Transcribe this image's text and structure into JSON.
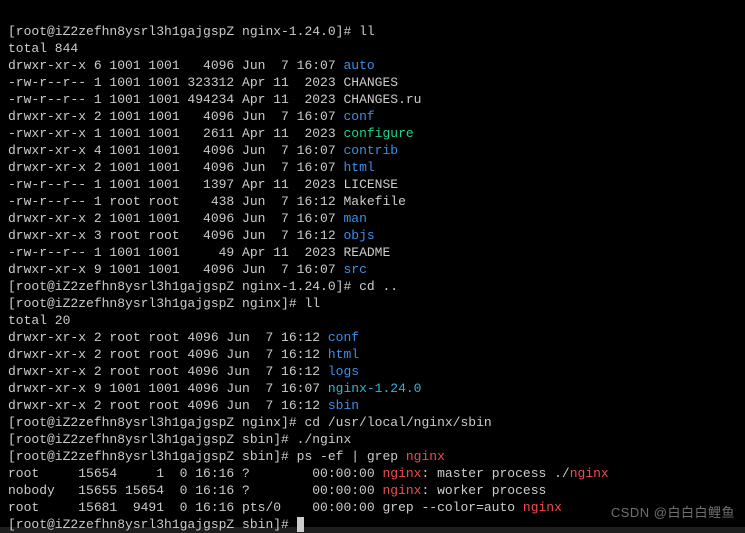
{
  "prompts": {
    "p1": "[root@iZ2zefhn8ysrl3h1gajgspZ nginx-1.24.0]# ",
    "p2": "[root@iZ2zefhn8ysrl3h1gajgspZ nginx]# ",
    "p3": "[root@iZ2zefhn8ysrl3h1gajgspZ sbin]# "
  },
  "cmds": {
    "ll": "ll",
    "cdup": "cd ..",
    "cdsbin": "cd /usr/local/nginx/sbin",
    "startnginx": "./nginx",
    "psg_pre": "ps -ef | grep ",
    "psg_word": "nginx"
  },
  "total1": "total 844",
  "ls1": [
    {
      "perm": "drwxr-xr-x 6 1001 1001   4096 Jun  7 16:07 ",
      "name": "auto",
      "cls": "bl"
    },
    {
      "perm": "-rw-r--r-- 1 1001 1001 323312 Apr 11  2023 ",
      "name": "CHANGES",
      "cls": "w"
    },
    {
      "perm": "-rw-r--r-- 1 1001 1001 494234 Apr 11  2023 ",
      "name": "CHANGES.ru",
      "cls": "w"
    },
    {
      "perm": "drwxr-xr-x 2 1001 1001   4096 Jun  7 16:07 ",
      "name": "conf",
      "cls": "bl"
    },
    {
      "perm": "-rwxr-xr-x 1 1001 1001   2611 Apr 11  2023 ",
      "name": "configure",
      "cls": "gr"
    },
    {
      "perm": "drwxr-xr-x 4 1001 1001   4096 Jun  7 16:07 ",
      "name": "contrib",
      "cls": "bl"
    },
    {
      "perm": "drwxr-xr-x 2 1001 1001   4096 Jun  7 16:07 ",
      "name": "html",
      "cls": "bl"
    },
    {
      "perm": "-rw-r--r-- 1 1001 1001   1397 Apr 11  2023 ",
      "name": "LICENSE",
      "cls": "w"
    },
    {
      "perm": "-rw-r--r-- 1 root root    438 Jun  7 16:12 ",
      "name": "Makefile",
      "cls": "w"
    },
    {
      "perm": "drwxr-xr-x 2 1001 1001   4096 Jun  7 16:07 ",
      "name": "man",
      "cls": "bl"
    },
    {
      "perm": "drwxr-xr-x 3 root root   4096 Jun  7 16:12 ",
      "name": "objs",
      "cls": "bl"
    },
    {
      "perm": "-rw-r--r-- 1 1001 1001     49 Apr 11  2023 ",
      "name": "README",
      "cls": "w"
    },
    {
      "perm": "drwxr-xr-x 9 1001 1001   4096 Jun  7 16:07 ",
      "name": "src",
      "cls": "bl"
    }
  ],
  "total2": "total 20",
  "ls2": [
    {
      "perm": "drwxr-xr-x 2 root root 4096 Jun  7 16:12 ",
      "name": "conf",
      "cls": "bl"
    },
    {
      "perm": "drwxr-xr-x 2 root root 4096 Jun  7 16:12 ",
      "name": "html",
      "cls": "bl"
    },
    {
      "perm": "drwxr-xr-x 2 root root 4096 Jun  7 16:12 ",
      "name": "logs",
      "cls": "bl"
    },
    {
      "perm": "drwxr-xr-x 9 1001 1001 4096 Jun  7 16:07 ",
      "name": "nginx-1.24.0",
      "cls": "cy"
    },
    {
      "perm": "drwxr-xr-x 2 root root 4096 Jun  7 16:12 ",
      "name": "sbin",
      "cls": "bl"
    }
  ],
  "ps": {
    "l1a": "root     15654     1  0 16:16 ?        00:00:00 ",
    "l1b": "nginx",
    "l1c": ": master process ./",
    "l1d": "nginx",
    "l2a": "nobody   15655 15654  0 16:16 ?        00:00:00 ",
    "l2b": "nginx",
    "l2c": ": worker process",
    "l3a": "root     15681  9491  0 16:16 pts/0    00:00:00 grep --color=auto ",
    "l3b": "nginx"
  },
  "watermark": "CSDN @白白白鲤鱼"
}
